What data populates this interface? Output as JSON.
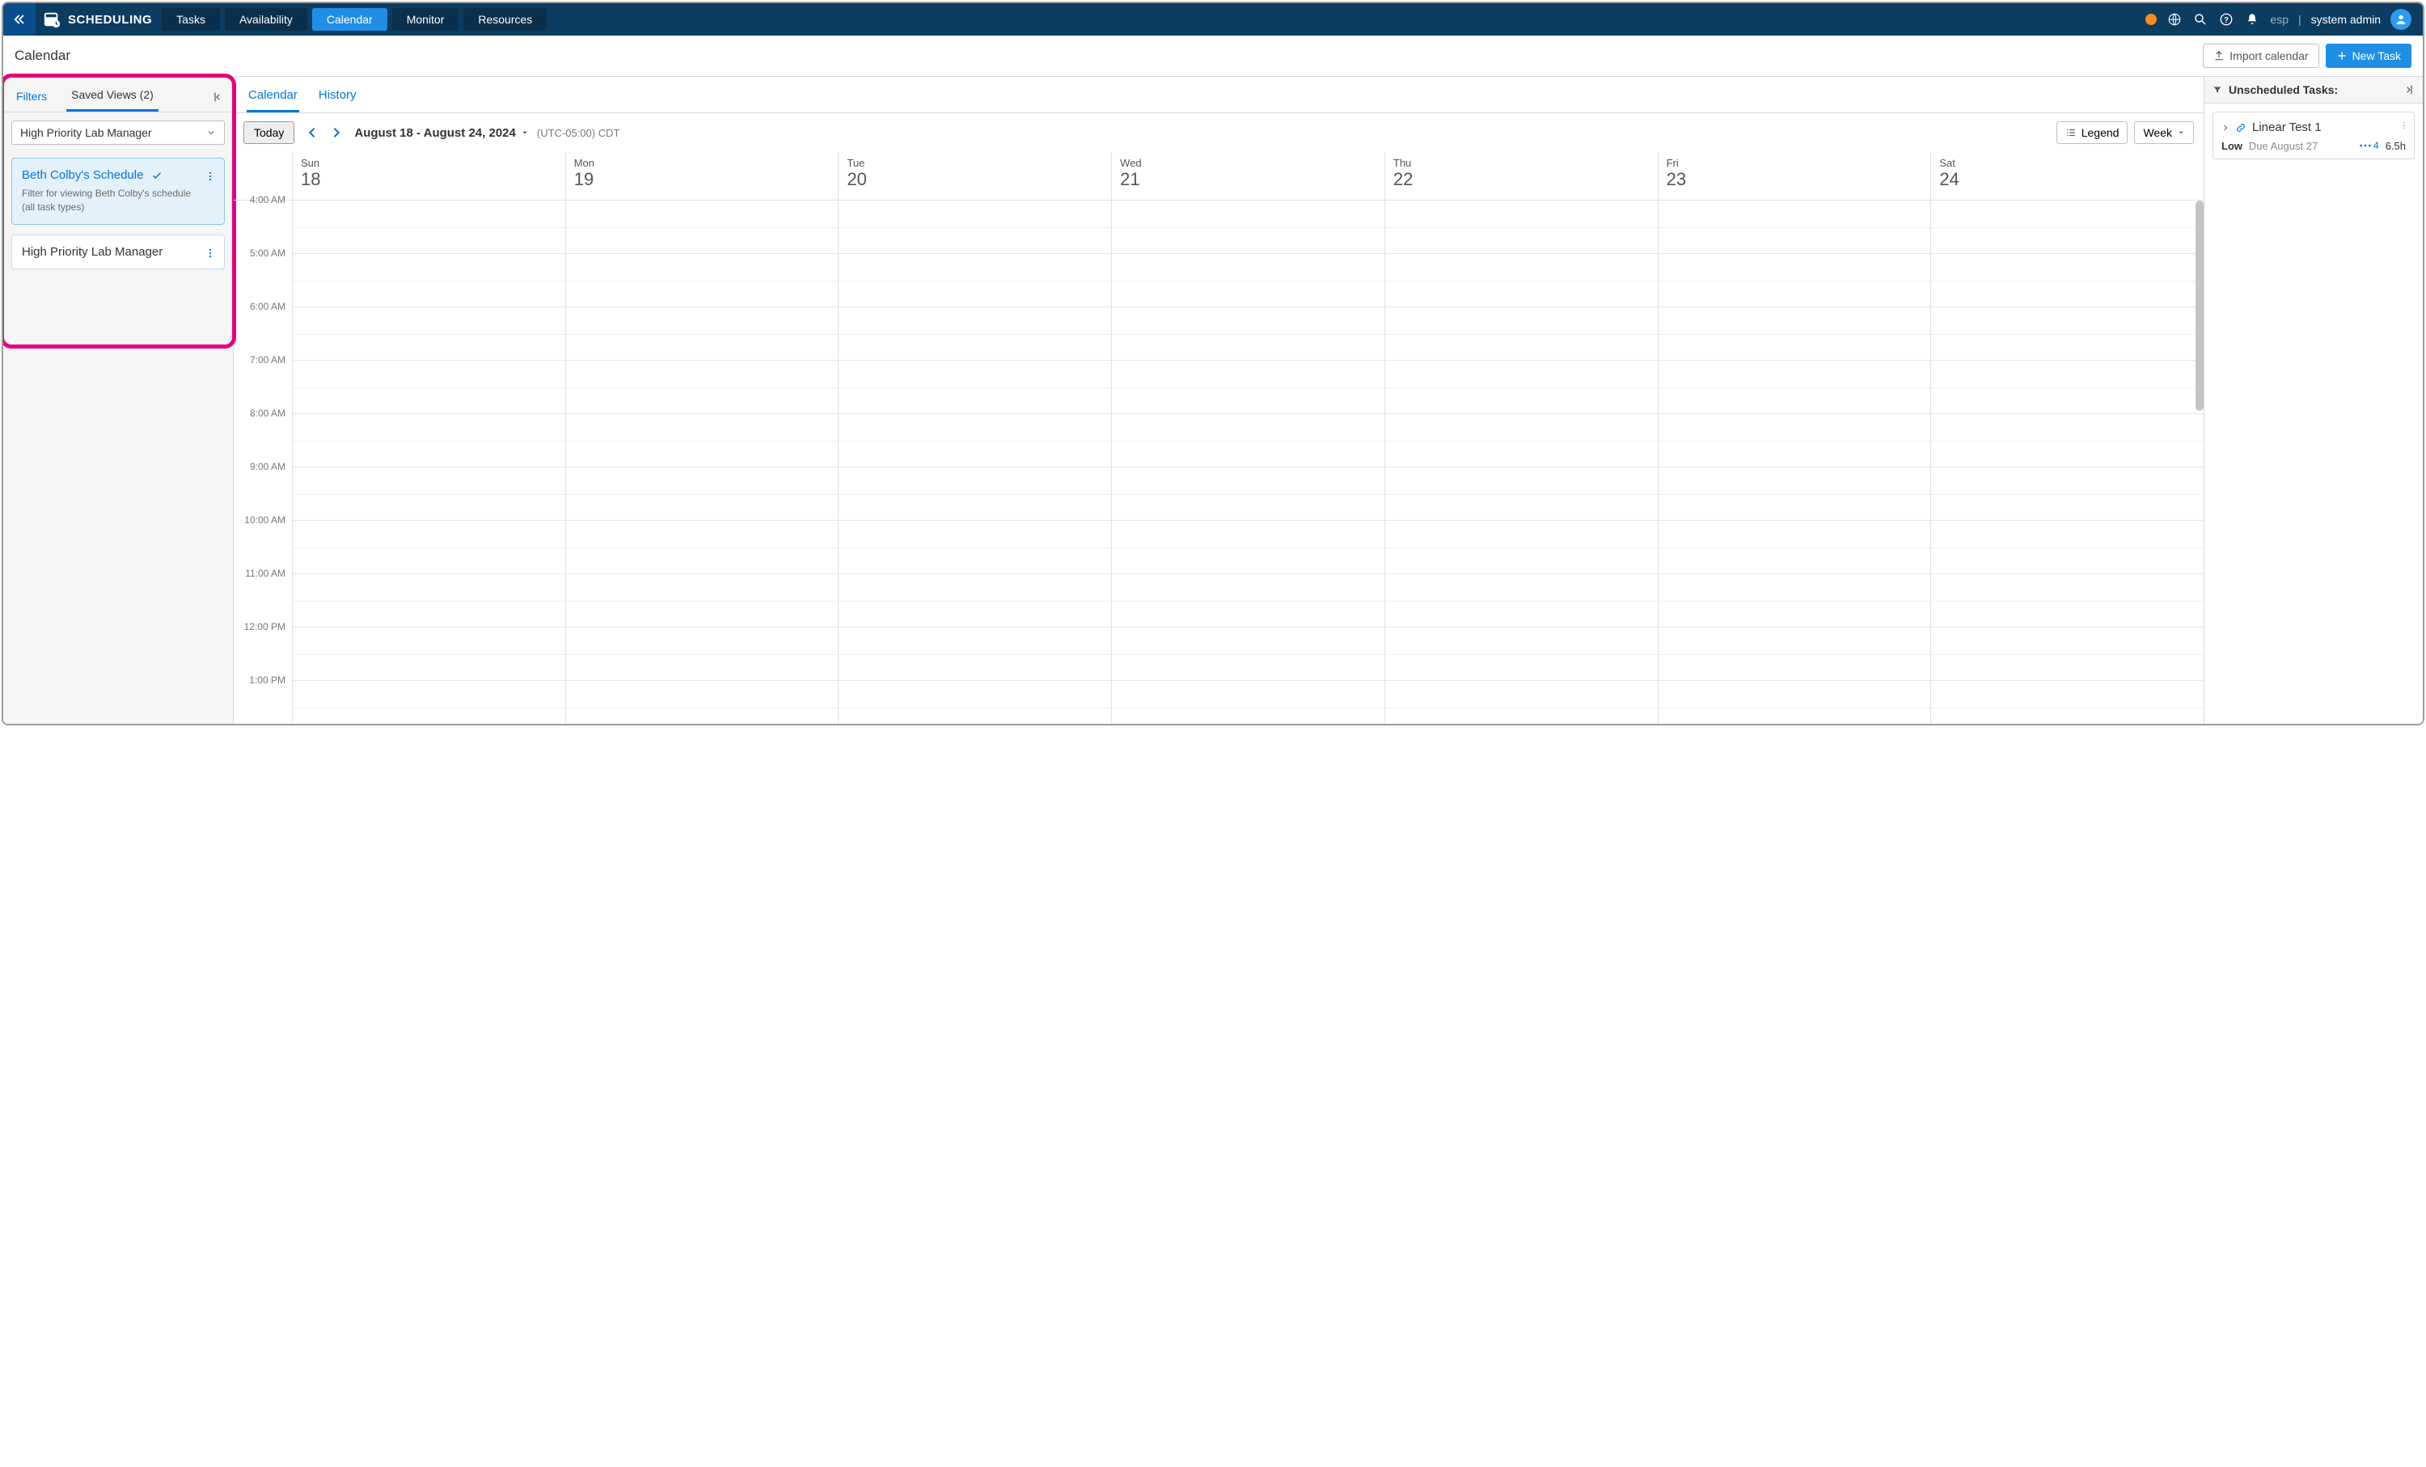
{
  "app": {
    "title": "SCHEDULING"
  },
  "nav": {
    "tabs": [
      "Tasks",
      "Availability",
      "Calendar",
      "Monitor",
      "Resources"
    ],
    "active_index": 2
  },
  "user": {
    "prefix": "esp",
    "sep": "|",
    "name": "system admin"
  },
  "page": {
    "title": "Calendar"
  },
  "header_actions": {
    "import": "Import calendar",
    "new_task": "New Task"
  },
  "sidebar": {
    "tabs": {
      "filters": "Filters",
      "saved_views": "Saved Views (2)"
    },
    "select_value": "High Priority Lab Manager",
    "views": [
      {
        "name": "Beth Colby's Schedule",
        "desc": "Filter for viewing Beth Colby's schedule (all task types)",
        "active": true
      },
      {
        "name": "High Priority Lab Manager",
        "desc": "",
        "active": false
      }
    ]
  },
  "calendar": {
    "tabs": [
      "Calendar",
      "History"
    ],
    "active_index": 0,
    "today": "Today",
    "date_range": "August 18 - August 24, 2024",
    "timezone": "(UTC-05:00) CDT",
    "legend": "Legend",
    "view_mode": "Week",
    "days": [
      {
        "label": "Sun",
        "num": "18"
      },
      {
        "label": "Mon",
        "num": "19"
      },
      {
        "label": "Tue",
        "num": "20"
      },
      {
        "label": "Wed",
        "num": "21"
      },
      {
        "label": "Thu",
        "num": "22"
      },
      {
        "label": "Fri",
        "num": "23"
      },
      {
        "label": "Sat",
        "num": "24"
      }
    ],
    "hours": [
      "4:00 AM",
      "5:00 AM",
      "6:00 AM",
      "7:00 AM",
      "8:00 AM",
      "9:00 AM",
      "10:00 AM",
      "11:00 AM",
      "12:00 PM",
      "1:00 PM"
    ]
  },
  "unscheduled": {
    "title": "Unscheduled Tasks:",
    "tasks": [
      {
        "name": "Linear Test 1",
        "priority": "Low",
        "due": "Due August 27",
        "badge": "4",
        "hours": "6.5h"
      }
    ]
  }
}
